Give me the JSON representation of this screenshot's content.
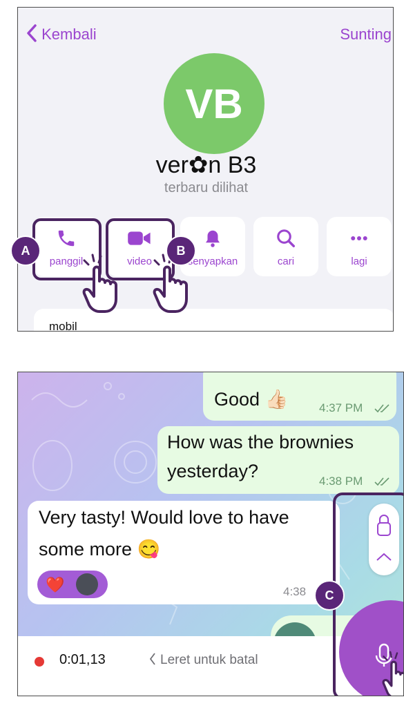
{
  "profile": {
    "back_label": "Kembali",
    "edit_label": "Sunting",
    "avatar_initials": "VB",
    "name": "ver✿n B3",
    "status": "terbaru dilihat",
    "actions": [
      {
        "label": "panggil",
        "icon": "phone-icon"
      },
      {
        "label": "video",
        "icon": "video-camera-icon"
      },
      {
        "label": "senyapkan",
        "icon": "bell-icon"
      },
      {
        "label": "cari",
        "icon": "search-icon"
      },
      {
        "label": "lagi",
        "icon": "more-icon"
      }
    ],
    "info_text": "mobil"
  },
  "callouts": {
    "a": "A",
    "b": "B",
    "c": "C"
  },
  "chat": {
    "messages": [
      {
        "direction": "out",
        "text": "Good 👍🏻",
        "time": "4:37 PM"
      },
      {
        "direction": "out",
        "line1": "How was the brownies",
        "line2": "yesterday?",
        "time": "4:38 PM"
      },
      {
        "direction": "in",
        "line1": "Very tasty! Would love to have",
        "line2": "some more 😋",
        "time": "4:38"
      }
    ],
    "reaction": "❤️",
    "recording_time": "0:01,13",
    "cancel_hint": "Leret untuk batal"
  },
  "colors": {
    "accent": "#9b45cf",
    "badge": "#5a2678",
    "avatar": "#7cc96a",
    "record": "#e53935"
  }
}
